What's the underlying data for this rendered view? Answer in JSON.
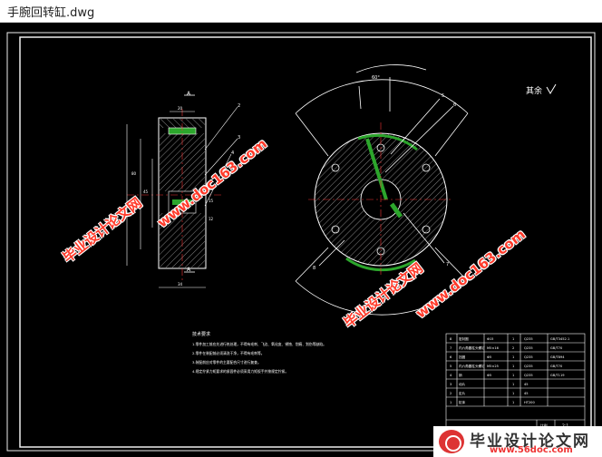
{
  "window": {
    "title": "手腕回转缸.dwg"
  },
  "drawing": {
    "surface_label": "其余",
    "tech_requirements_title": "技术要求",
    "tech_requirements": [
      "1.零件加工前应先进行热处理，不得有毛刺、飞边、氧化皮、锈蚀、划痕、划伤等缺陷。",
      "2.零件在装配前必须清洗干净，不得有毛刺等。",
      "3.装配前应对零件的主要配合尺寸进行复查。",
      "4.规定拧紧力矩要求的紧固件必须采用力矩扳手并按规定拧紧。"
    ],
    "bom_rows": [
      {
        "no": "8",
        "name": "密封圈",
        "spec": "Φ15",
        "qty": "1",
        "mat": "Q235",
        "note": "GB/T3452.1"
      },
      {
        "no": "7",
        "name": "内六角圆柱头螺钉",
        "spec": "M5×16",
        "qty": "2",
        "mat": "Q235",
        "note": "GB/T70"
      },
      {
        "no": "6",
        "name": "挡圈",
        "spec": "Φ5",
        "qty": "1",
        "mat": "Q235",
        "note": "GB/T894"
      },
      {
        "no": "5",
        "name": "内六角圆柱头螺钉",
        "spec": "M5×25",
        "qty": "1",
        "mat": "Q235",
        "note": "GB/T70"
      },
      {
        "no": "4",
        "name": "销",
        "spec": "Φ5",
        "qty": "1",
        "mat": "Q235",
        "note": "GB/T119"
      },
      {
        "no": "3",
        "name": "动片",
        "spec": "",
        "qty": "1",
        "mat": "45",
        "note": ""
      },
      {
        "no": "2",
        "name": "定片",
        "spec": "",
        "qty": "1",
        "mat": "45",
        "note": ""
      },
      {
        "no": "1",
        "name": "缸体",
        "spec": "",
        "qty": "1",
        "mat": "HT200",
        "note": ""
      }
    ],
    "title_block": {
      "name": "手腕回转缸装配图",
      "scale_label": "比例",
      "scale": "2:1",
      "sheet_label": "图号",
      "sheet": "A2"
    },
    "dimensions": {
      "angle": "60°",
      "d1": "45",
      "d2": "80",
      "d3": "20",
      "d4": "34",
      "d5": "15",
      "d6": "12"
    },
    "callouts": [
      "1",
      "2",
      "3",
      "4",
      "5",
      "6",
      "7",
      "8"
    ],
    "section_letters": [
      "A",
      "A"
    ]
  },
  "watermarks": {
    "url": "www.doc163.com",
    "cn": "毕业设计论文网"
  },
  "site_logo": {
    "name": "毕业设计论文网",
    "url": "www.56doc.com"
  }
}
